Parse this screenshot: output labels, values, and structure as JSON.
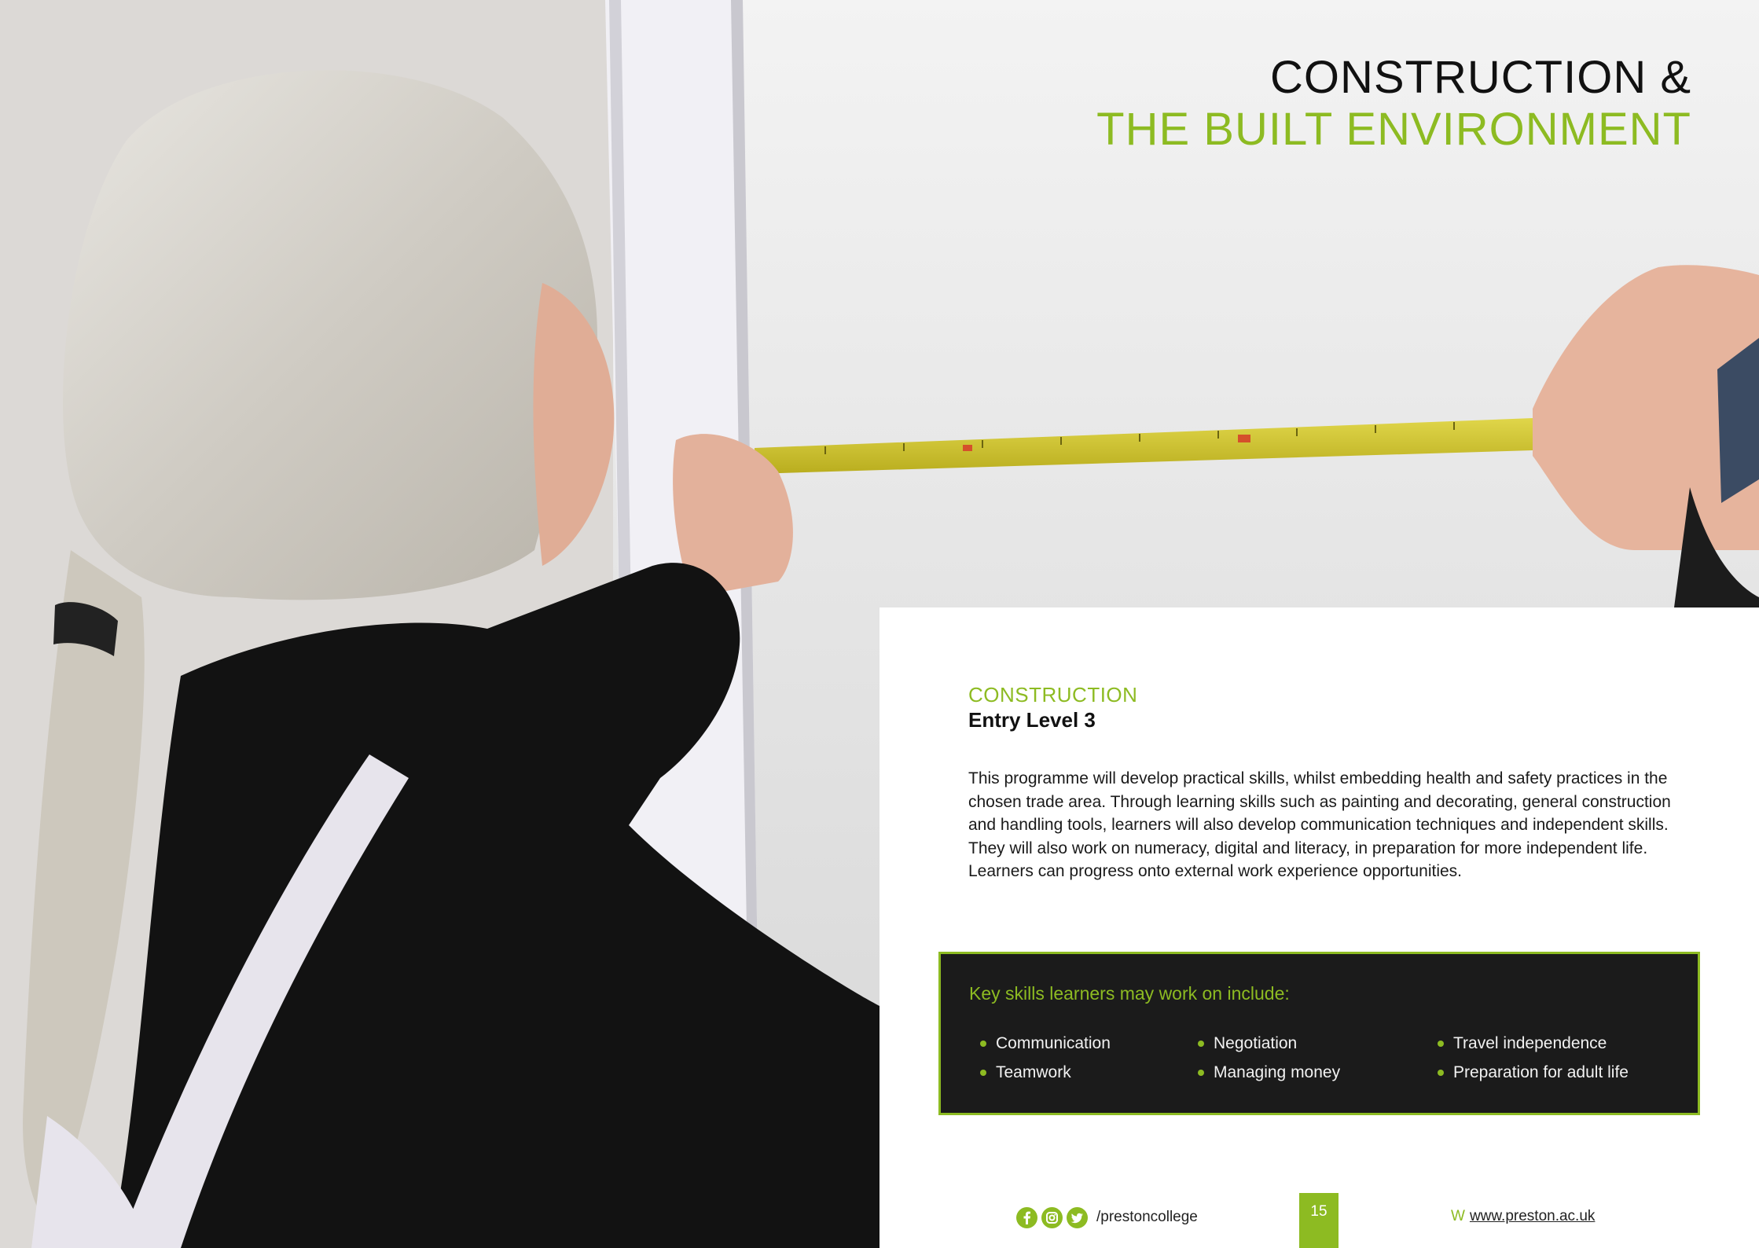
{
  "title": {
    "line1": "CONSTRUCTION &",
    "line2": "THE BUILT ENVIRONMENT"
  },
  "course": {
    "category": "CONSTRUCTION",
    "level": "Entry Level 3",
    "description": "This programme will develop practical skills, whilst embedding health and safety practices in the chosen trade area. Through learning skills such as painting and decorating, general construction and handling tools, learners will also develop communication techniques and independent skills. They will also work on numeracy, digital and literacy, in preparation for more independent life. Learners can progress onto external work experience opportunities."
  },
  "skills": {
    "title": "Key skills learners may work on include:",
    "columns": [
      [
        "Communication",
        "Teamwork"
      ],
      [
        "Negotiation",
        "Managing money"
      ],
      [
        "Travel independence",
        "Preparation for adult life"
      ]
    ]
  },
  "footer": {
    "social_icons": [
      "facebook-icon",
      "instagram-icon",
      "twitter-icon"
    ],
    "social_handle": "/prestoncollege",
    "page_number": "15",
    "web_prefix": "W",
    "web_url": "www.preston.ac.uk"
  },
  "colors": {
    "accent": "#8dbb22",
    "dark_box": "#1b1b1b",
    "text": "#111111"
  }
}
